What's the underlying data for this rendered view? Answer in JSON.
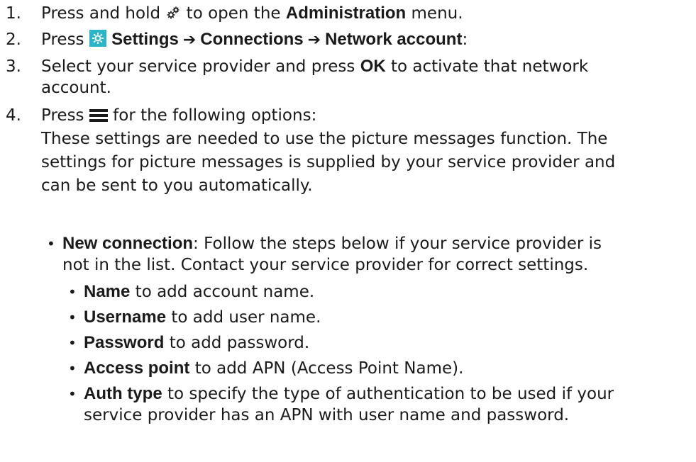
{
  "steps": [
    {
      "num": "1.",
      "pre": "Press and hold ",
      "post": " to open the ",
      "bold": "Administration",
      "end": " menu."
    },
    {
      "num": "2.",
      "pre": "Press ",
      "b1": "Settings",
      "b2": "Connections",
      "b3": "Network account",
      "end": ":"
    },
    {
      "num": "3.",
      "pre": "Select your service provider and press ",
      "bold": "OK",
      "post": " to activate that network",
      "line2": "account."
    },
    {
      "num": "4.",
      "pre": "Press ",
      "post": " for the following options:"
    }
  ],
  "paragraph": [
    "These settings are needed to use the picture messages function. The",
    "settings for picture messages is supplied by your service provider and",
    "can be sent to you automatically."
  ],
  "bullet": {
    "bold": "New connection",
    "text": ": Follow the steps below if your service provider is",
    "line2": "not in the list. Contact your service provider for correct settings."
  },
  "subbullets": [
    {
      "bold": "Name",
      "text": " to add account name."
    },
    {
      "bold": "Username",
      "text": " to add user name."
    },
    {
      "bold": "Password",
      "text": " to add password."
    },
    {
      "bold": "Access point",
      "text": " to add APN (Access Point Name)."
    },
    {
      "bold": "Auth type",
      "text": " to specify the type of authentication to be used if your",
      "line2": "service provider has an APN with user name and password."
    }
  ],
  "bullet_symbol": "•",
  "arrow_symbol": "➔",
  "icons": {
    "step1": "gear-cluster-icon",
    "step2": "settings-gear-icon",
    "step4": "menu-icon"
  },
  "colors": {
    "settings_icon_bg": "#2bb5c8",
    "text": "#1a1a1a"
  }
}
